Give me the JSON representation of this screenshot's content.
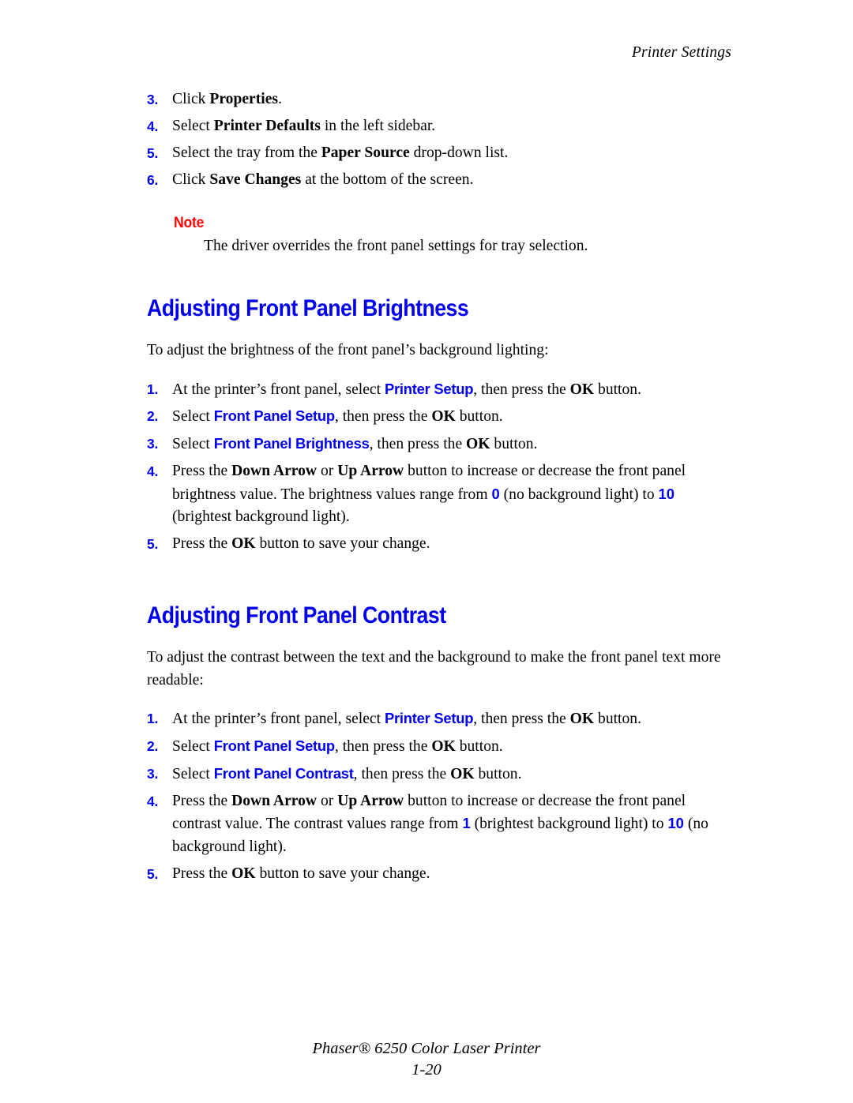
{
  "header": {
    "running_head": "Printer Settings"
  },
  "colors": {
    "ui_blue": "#0000EE",
    "note_red": "#FF0000",
    "body_black": "#000000"
  },
  "top_steps": [
    {
      "num": "3.",
      "parts": [
        {
          "t": "Click ",
          "s": "plain"
        },
        {
          "t": "Properties",
          "s": "bold"
        },
        {
          "t": ".",
          "s": "plain"
        }
      ]
    },
    {
      "num": "4.",
      "parts": [
        {
          "t": "Select ",
          "s": "plain"
        },
        {
          "t": "Printer Defaults",
          "s": "bold"
        },
        {
          "t": " in the left sidebar.",
          "s": "plain"
        }
      ]
    },
    {
      "num": "5.",
      "parts": [
        {
          "t": "Select the tray from the ",
          "s": "plain"
        },
        {
          "t": "Paper Source",
          "s": "bold"
        },
        {
          "t": " drop-down list.",
          "s": "plain"
        }
      ]
    },
    {
      "num": "6.",
      "parts": [
        {
          "t": "Click ",
          "s": "plain"
        },
        {
          "t": "Save Changes",
          "s": "bold"
        },
        {
          "t": " at the bottom of the screen.",
          "s": "plain"
        }
      ]
    }
  ],
  "note": {
    "label": "Note",
    "body": "The driver overrides the front panel settings for tray selection."
  },
  "brightness": {
    "heading": "Adjusting Front Panel Brightness",
    "intro": "To adjust the brightness of the front panel’s background lighting:",
    "steps": [
      {
        "num": "1.",
        "parts": [
          {
            "t": "At the printer’s front panel, select ",
            "s": "plain"
          },
          {
            "t": "Printer Setup",
            "s": "ui"
          },
          {
            "t": ", then press the ",
            "s": "plain"
          },
          {
            "t": "OK",
            "s": "bold"
          },
          {
            "t": " button.",
            "s": "plain"
          }
        ]
      },
      {
        "num": "2.",
        "parts": [
          {
            "t": "Select ",
            "s": "plain"
          },
          {
            "t": "Front Panel Setup",
            "s": "ui"
          },
          {
            "t": ", then press the ",
            "s": "plain"
          },
          {
            "t": "OK",
            "s": "bold"
          },
          {
            "t": " button.",
            "s": "plain"
          }
        ]
      },
      {
        "num": "3.",
        "parts": [
          {
            "t": "Select ",
            "s": "plain"
          },
          {
            "t": "Front Panel Brightness",
            "s": "ui"
          },
          {
            "t": ", then press the ",
            "s": "plain"
          },
          {
            "t": "OK",
            "s": "bold"
          },
          {
            "t": " button.",
            "s": "plain"
          }
        ]
      },
      {
        "num": "4.",
        "parts": [
          {
            "t": "Press the ",
            "s": "plain"
          },
          {
            "t": "Down Arrow",
            "s": "bold"
          },
          {
            "t": " or ",
            "s": "plain"
          },
          {
            "t": "Up Arrow",
            "s": "bold"
          },
          {
            "t": " button to increase or decrease the front panel brightness value. The brightness values range from ",
            "s": "plain"
          },
          {
            "t": "0",
            "s": "val"
          },
          {
            "t": " (no background light) to ",
            "s": "plain"
          },
          {
            "t": "10",
            "s": "val"
          },
          {
            "t": " (brightest background light).",
            "s": "plain"
          }
        ]
      },
      {
        "num": "5.",
        "parts": [
          {
            "t": "Press the ",
            "s": "plain"
          },
          {
            "t": "OK",
            "s": "bold"
          },
          {
            "t": " button to save your change.",
            "s": "plain"
          }
        ]
      }
    ]
  },
  "contrast": {
    "heading": "Adjusting Front Panel Contrast",
    "intro": "To adjust the contrast between the text and the background to make the front panel text more readable:",
    "steps": [
      {
        "num": "1.",
        "parts": [
          {
            "t": "At the printer’s front panel, select ",
            "s": "plain"
          },
          {
            "t": "Printer Setup",
            "s": "ui"
          },
          {
            "t": ", then press the ",
            "s": "plain"
          },
          {
            "t": "OK",
            "s": "bold"
          },
          {
            "t": " button.",
            "s": "plain"
          }
        ]
      },
      {
        "num": "2.",
        "parts": [
          {
            "t": "Select ",
            "s": "plain"
          },
          {
            "t": "Front Panel Setup",
            "s": "ui"
          },
          {
            "t": ", then press the ",
            "s": "plain"
          },
          {
            "t": "OK",
            "s": "bold"
          },
          {
            "t": " button.",
            "s": "plain"
          }
        ]
      },
      {
        "num": "3.",
        "parts": [
          {
            "t": "Select ",
            "s": "plain"
          },
          {
            "t": "Front Panel Contrast",
            "s": "ui"
          },
          {
            "t": ", then press the ",
            "s": "plain"
          },
          {
            "t": "OK",
            "s": "bold"
          },
          {
            "t": " button.",
            "s": "plain"
          }
        ]
      },
      {
        "num": "4.",
        "parts": [
          {
            "t": "Press the ",
            "s": "plain"
          },
          {
            "t": "Down Arrow",
            "s": "bold"
          },
          {
            "t": " or ",
            "s": "plain"
          },
          {
            "t": "Up Arrow",
            "s": "bold"
          },
          {
            "t": " button to increase or decrease the front panel contrast value. The contrast values range from ",
            "s": "plain"
          },
          {
            "t": "1",
            "s": "val"
          },
          {
            "t": " (brightest background light) to ",
            "s": "plain"
          },
          {
            "t": "10",
            "s": "val"
          },
          {
            "t": " (no background light).",
            "s": "plain"
          }
        ]
      },
      {
        "num": "5.",
        "parts": [
          {
            "t": "Press the ",
            "s": "plain"
          },
          {
            "t": "OK",
            "s": "bold"
          },
          {
            "t": " button to save your change.",
            "s": "plain"
          }
        ]
      }
    ]
  },
  "footer": {
    "product": "Phaser® 6250 Color Laser Printer",
    "page_number": "1-20"
  }
}
